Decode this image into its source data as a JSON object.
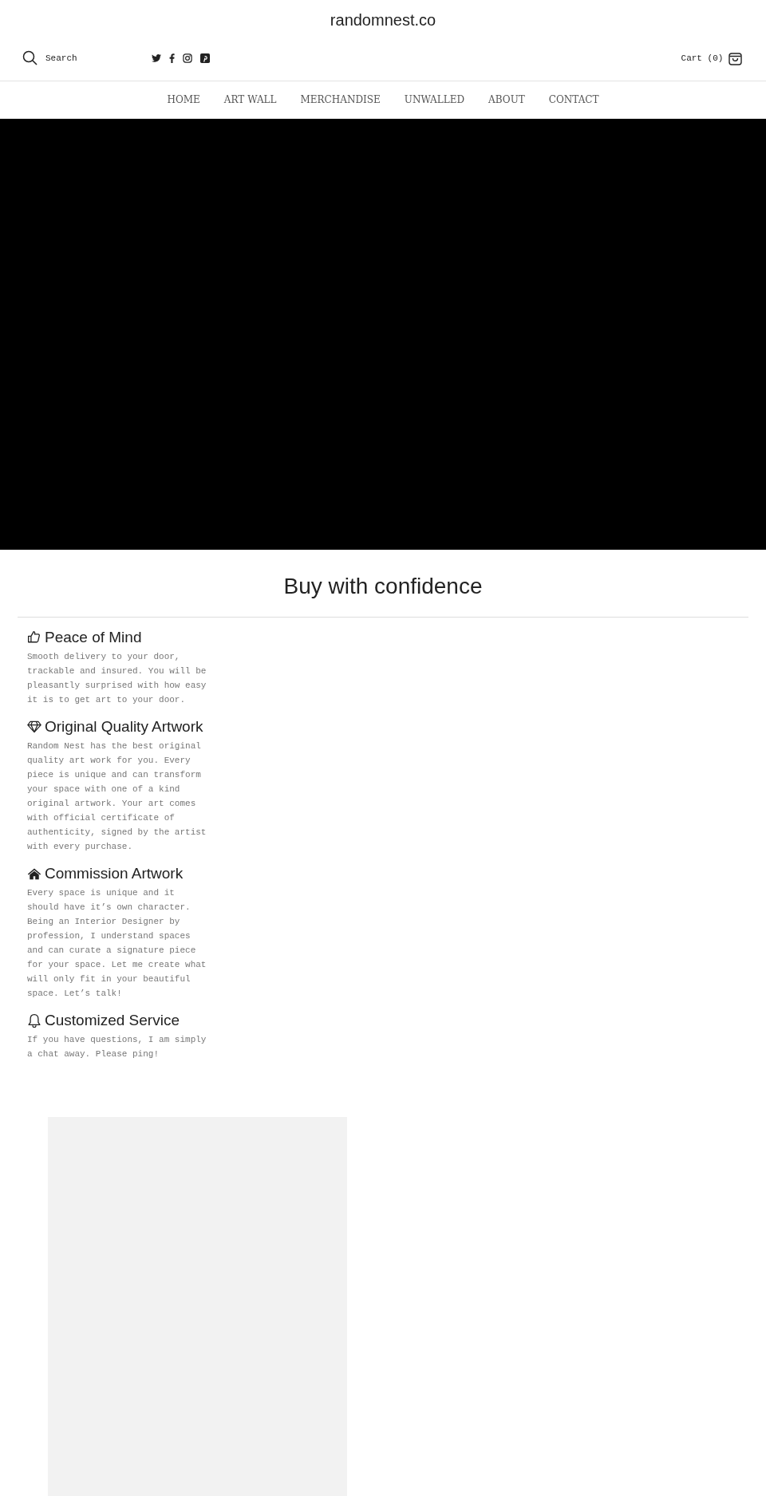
{
  "header": {
    "site_title": "randomnest.co",
    "search": {
      "placeholder": "Search"
    },
    "cart": {
      "label": "Cart",
      "count": "(0)"
    }
  },
  "nav": [
    {
      "label": "HOME"
    },
    {
      "label": "ART WALL"
    },
    {
      "label": "MERCHANDISE"
    },
    {
      "label": "UNWALLED"
    },
    {
      "label": "ABOUT"
    },
    {
      "label": "CONTACT"
    }
  ],
  "features": {
    "title": "Buy with confidence",
    "items": [
      {
        "title": "Peace of Mind",
        "text": "Smooth delivery to your door, trackable and insured. You will be pleasantly surprised with how easy it is to get art to your door."
      },
      {
        "title": "Original Quality Artwork",
        "text": "Random Nest has the best original quality art work for you. Every piece is unique and can transform your space with one of a kind original artwork. Your art comes with official certificate of authenticity, signed by the artist with every purchase."
      },
      {
        "title": "Commission Artwork",
        "text": "Every space is unique and it should have it’s own character. Being an Interior Designer by profession, I understand spaces and can curate a signature piece for your space. Let me create what will only fit in your beautiful space. Let’s talk!"
      },
      {
        "title": "Customized Service",
        "text": "If you have questions, I am simply a chat away. Please ping!"
      }
    ]
  }
}
